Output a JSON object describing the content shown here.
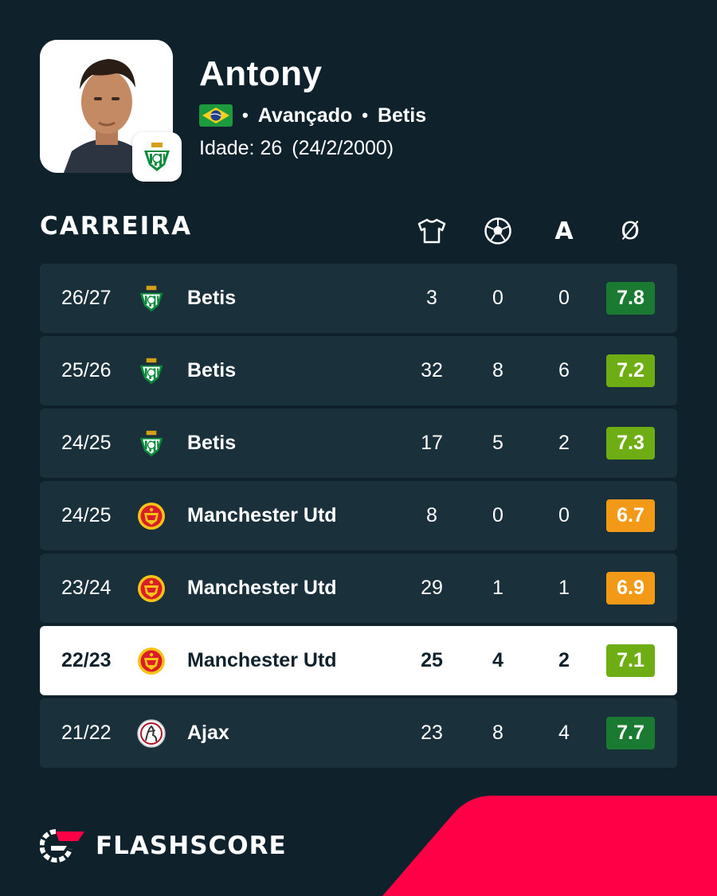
{
  "player": {
    "name": "Antony",
    "position": "Avançado",
    "club": "Betis",
    "age_label": "Idade: 26",
    "birthdate": "(24/2/2000)",
    "flag_icon": "brazil-flag-icon"
  },
  "career": {
    "title": "CARREIRA",
    "columns": {
      "matches_icon": "shirt-icon",
      "goals_icon": "football-icon",
      "assists_label": "A",
      "average_label": "Ø"
    },
    "rows": [
      {
        "season": "26/27",
        "team": "Betis",
        "crest": "betis-crest-icon",
        "matches": "3",
        "goals": "0",
        "assists": "0",
        "rating": "7.8",
        "rating_color": "#1b7a32",
        "highlighted": false
      },
      {
        "season": "25/26",
        "team": "Betis",
        "crest": "betis-crest-icon",
        "matches": "32",
        "goals": "8",
        "assists": "6",
        "rating": "7.2",
        "rating_color": "#6fad14",
        "highlighted": false
      },
      {
        "season": "24/25",
        "team": "Betis",
        "crest": "betis-crest-icon",
        "matches": "17",
        "goals": "5",
        "assists": "2",
        "rating": "7.3",
        "rating_color": "#6fad14",
        "highlighted": false
      },
      {
        "season": "24/25",
        "team": "Manchester Utd",
        "crest": "manchester-utd-crest-icon",
        "matches": "8",
        "goals": "0",
        "assists": "0",
        "rating": "6.7",
        "rating_color": "#f29a18",
        "highlighted": false
      },
      {
        "season": "23/24",
        "team": "Manchester Utd",
        "crest": "manchester-utd-crest-icon",
        "matches": "29",
        "goals": "1",
        "assists": "1",
        "rating": "6.9",
        "rating_color": "#f29a18",
        "highlighted": false
      },
      {
        "season": "22/23",
        "team": "Manchester Utd",
        "crest": "manchester-utd-crest-icon",
        "matches": "25",
        "goals": "4",
        "assists": "2",
        "rating": "7.1",
        "rating_color": "#6fad14",
        "highlighted": true
      },
      {
        "season": "21/22",
        "team": "Ajax",
        "crest": "ajax-crest-icon",
        "matches": "23",
        "goals": "8",
        "assists": "4",
        "rating": "7.7",
        "rating_color": "#1b7a32",
        "highlighted": false
      }
    ]
  },
  "brand": {
    "name": "FLASHSCORE",
    "accent_color": "#ff0046"
  }
}
